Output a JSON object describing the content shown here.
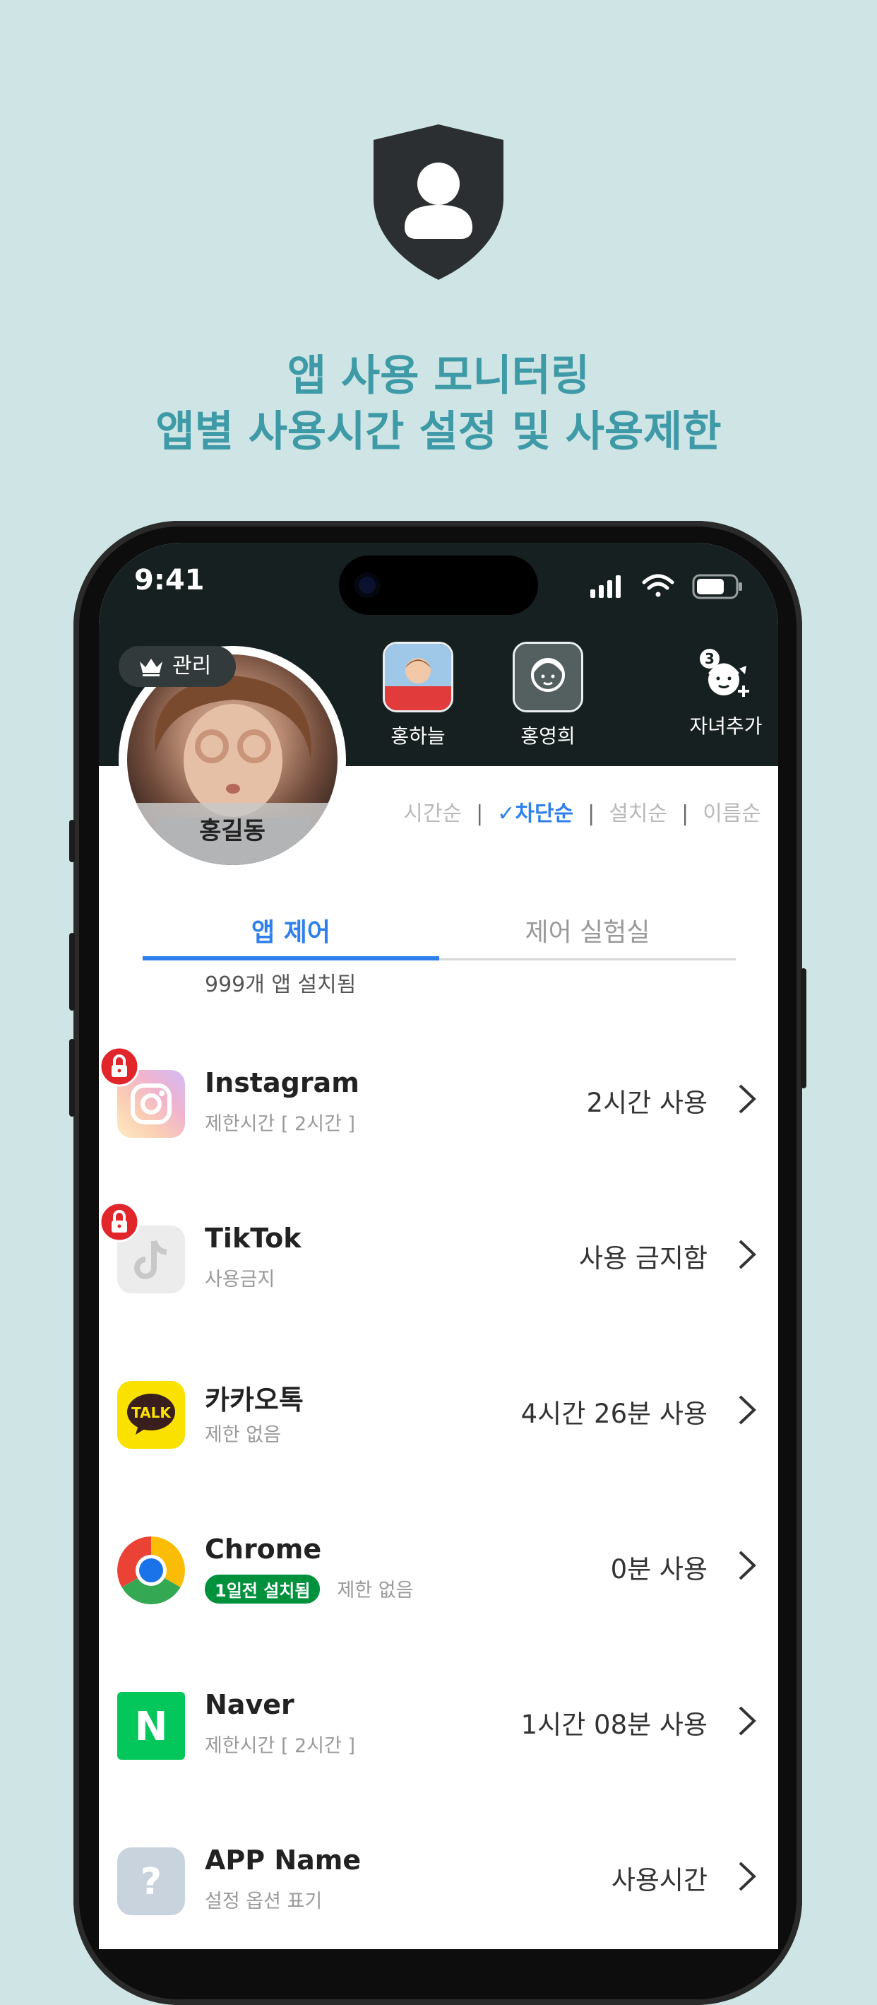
{
  "promo": {
    "headline_line1": "앱 사용 모니터링",
    "headline_line2": "앱별 사용시간 설정 및 사용제한",
    "hero_icon": "shield-user-icon"
  },
  "status_bar": {
    "time": "9:41",
    "icons": [
      "signal-icon",
      "wifi-icon",
      "battery-icon"
    ]
  },
  "profile": {
    "badge_label": "관리",
    "name": "홍길동"
  },
  "children": [
    {
      "name": "홍하늘"
    },
    {
      "name": "홍영희"
    }
  ],
  "add_child": {
    "label": "자녀추가",
    "count": "3"
  },
  "sort_options": [
    "시간순",
    "차단순",
    "설치순",
    "이름순"
  ],
  "sort_active_label": "✓차단순",
  "tabs": [
    {
      "label": "앱 제어",
      "active": true
    },
    {
      "label": "제어 실험실",
      "active": false
    }
  ],
  "installed_count_text": "999개 앱 설치됨",
  "apps": [
    {
      "name": "Instagram",
      "sub": "제한시간 [ 2시간 ]",
      "usage": "2시간 사용",
      "locked": true,
      "icon": "instagram-icon"
    },
    {
      "name": "TikTok",
      "sub": "사용금지",
      "usage": "사용 금지함",
      "locked": true,
      "icon": "tiktok-icon"
    },
    {
      "name": "카카오톡",
      "sub": "제한 없음",
      "usage": "4시간 26분 사용",
      "locked": false,
      "icon": "kakaotalk-icon",
      "icon_text": "TALK"
    },
    {
      "name": "Chrome",
      "badge": "1일전 설치됨",
      "sub": "제한 없음",
      "usage": "0분 사용",
      "locked": false,
      "icon": "chrome-icon"
    },
    {
      "name": "Naver",
      "sub": "제한시간 [ 2시간 ]",
      "usage": "1시간 08분 사용",
      "locked": false,
      "icon": "naver-icon",
      "icon_text": "N"
    },
    {
      "name": "APP Name",
      "sub": "설정 옵션 표기",
      "usage": "사용시간",
      "locked": false,
      "icon": "unknown-app-icon",
      "icon_text": "?"
    }
  ],
  "colors": {
    "background": "#cfe5e5",
    "headline": "#3e9aa6",
    "accent": "#2f80ed",
    "topbar": "#172020",
    "lock_badge": "#e0252b",
    "new_badge": "#00913c"
  }
}
